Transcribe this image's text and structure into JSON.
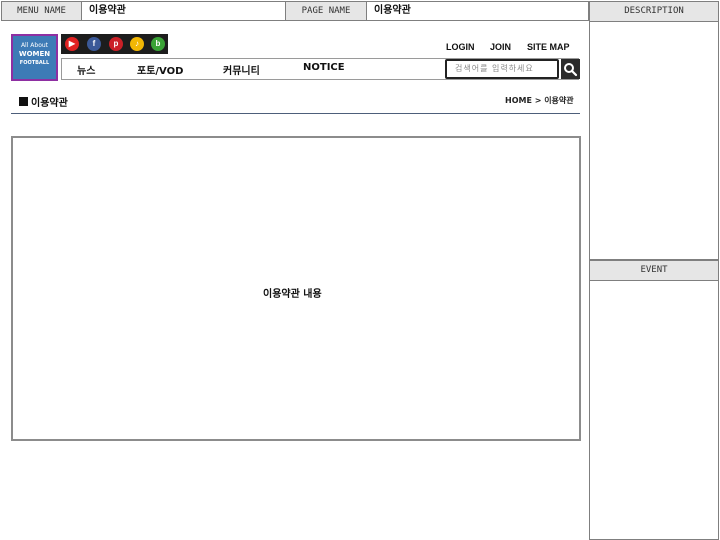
{
  "meta": {
    "menu_name_label": "MENU NAME",
    "menu_name_value": "이용약관",
    "page_name_label": "PAGE NAME",
    "page_name_value": "이용약관"
  },
  "side": {
    "description_label": "DESCRIPTION",
    "event_label": "EVENT"
  },
  "logo": {
    "line1": "All About",
    "line2": "WOMEN",
    "line3": "FOOTBALL",
    "border_color": "#8e2fa2",
    "bg_color": "#3d7bb6"
  },
  "social": [
    {
      "name": "youtube-icon",
      "glyph": "▶",
      "color": "#e02323"
    },
    {
      "name": "facebook-icon",
      "glyph": "f",
      "color": "#3b5998"
    },
    {
      "name": "pinterest-icon",
      "glyph": "p",
      "color": "#cb2027"
    },
    {
      "name": "kakaostory-icon",
      "glyph": "♪",
      "color": "#f2b705"
    },
    {
      "name": "naver-blog-icon",
      "glyph": "b",
      "color": "#3aa336"
    }
  ],
  "util": {
    "login": "LOGIN",
    "join": "JOIN",
    "sitemap": "SITE MAP"
  },
  "nav": {
    "items": [
      "뉴스",
      "포토/VOD",
      "커뮤니티",
      "NOTICE"
    ]
  },
  "search": {
    "placeholder": "검색어를 입력하세요"
  },
  "page": {
    "title": "이용약관",
    "breadcrumb": "HOME > 이용약관"
  },
  "content": {
    "body_text": "이용약관 내용"
  }
}
